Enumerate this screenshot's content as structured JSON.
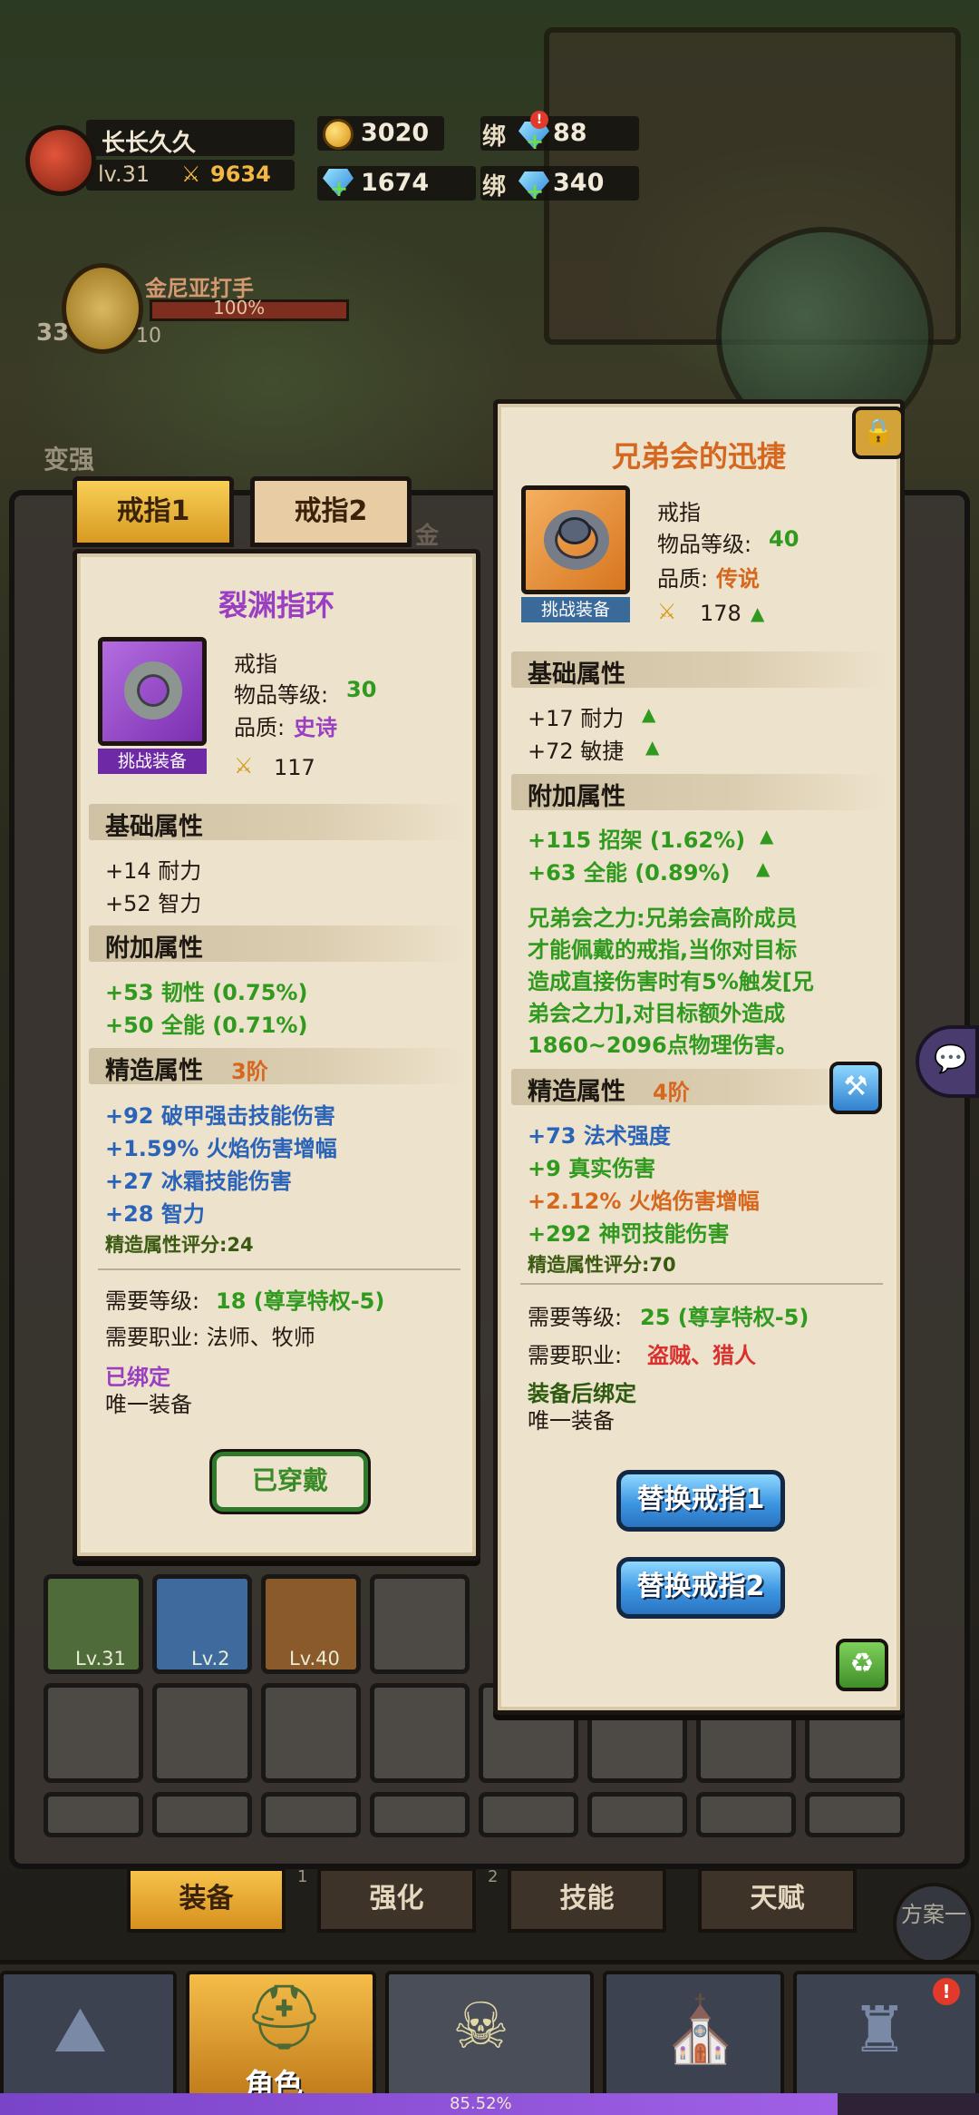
{
  "hud": {
    "player_name": "长长久久",
    "level": "lv.31",
    "power": "9634",
    "gold": "3020",
    "bound_label": "绑",
    "bound_gems_top": "88",
    "gems": "1674",
    "bound_gems": "340",
    "notif_badge": "!"
  },
  "boss": {
    "name": "金尼亚打手",
    "progress": "100%",
    "num1": "33",
    "num2": "10"
  },
  "strong_label": "变强",
  "tabs": {
    "ring1": "戒指1",
    "ring2": "戒指2",
    "side_label": "金"
  },
  "left_card": {
    "title": "裂渊指环",
    "item_type": "戒指",
    "item_level_label": "物品等级:",
    "item_level": "30",
    "quality_label": "品质:",
    "quality": "史诗",
    "tag": "挑战装备",
    "score": "117",
    "base_header": "基础属性",
    "base": [
      "+14 耐力",
      "+52 智力"
    ],
    "extra_header": "附加属性",
    "extra": [
      "+53 韧性 (0.75%)",
      "+50 全能 (0.71%)"
    ],
    "forge_header": "精造属性",
    "forge_tier": "3阶",
    "forge": [
      "+92 破甲强击技能伤害",
      "+1.59% 火焰伤害增幅",
      "+27 冰霜技能伤害",
      "+28 智力"
    ],
    "forge_score": "精造属性评分:24",
    "req_level_label": "需要等级:",
    "req_level": "18 (尊享特权-5)",
    "req_class": "需要职业: 法师、牧师",
    "bound": "已绑定",
    "unique": "唯一装备",
    "equipped_btn": "已穿戴"
  },
  "right_card": {
    "title": "兄弟会的迅捷",
    "item_type": "戒指",
    "item_level_label": "物品等级:",
    "item_level": "40",
    "quality_label": "品质:",
    "quality": "传说",
    "tag": "挑战装备",
    "score": "178",
    "base_header": "基础属性",
    "base": [
      "+17 耐力",
      "+72 敏捷"
    ],
    "extra_header": "附加属性",
    "extra": [
      "+115 招架 (1.62%)",
      "+63 全能 (0.89%)"
    ],
    "desc": [
      "兄弟会之力:兄弟会高阶成员",
      "才能佩戴的戒指,当你对目标",
      "造成直接伤害时有5%触发[兄",
      "弟会之力],对目标额外造成",
      "1860~2096点物理伤害。"
    ],
    "forge_header": "精造属性",
    "forge_tier": "4阶",
    "forge": [
      "+73 法术强度",
      "+9 真实伤害",
      "+2.12% 火焰伤害增幅",
      "+292 神罚技能伤害"
    ],
    "forge_score": "精造属性评分:70",
    "req_level_label": "需要等级:",
    "req_level": "25 (尊享特权-5)",
    "req_class_label": "需要职业:",
    "req_class": "盗贼、猎人",
    "bind_on_equip": "装备后绑定",
    "unique": "唯一装备",
    "replace1_btn": "替换戒指1",
    "replace2_btn": "替换戒指2"
  },
  "inventory": {
    "slots": [
      "Lv.31",
      "Lv.2",
      "Lv.40"
    ]
  },
  "bottom_tabs": [
    "装备",
    "强化",
    "技能",
    "天赋"
  ],
  "tab_numbers": [
    "1",
    "2"
  ],
  "plan_btn": "方案一",
  "nav": {
    "active_label": "角色"
  },
  "xp": {
    "percent_text": "85.52%",
    "fraction": 0.8552
  },
  "colors": {
    "epic": "#9a3fc2",
    "legendary": "#d6671e",
    "green": "#2f9a1e",
    "blue": "#2a63b8"
  }
}
